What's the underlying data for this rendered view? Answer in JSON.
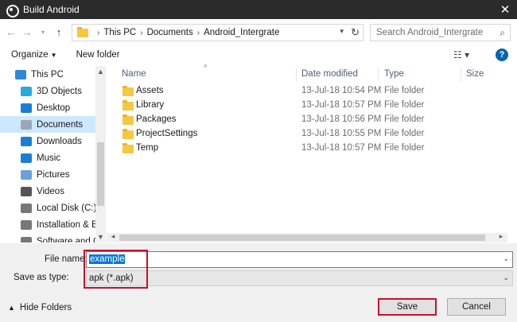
{
  "window": {
    "title": "Build Android",
    "close_label": "✕"
  },
  "address": {
    "breadcrumbs": [
      "This PC",
      "Documents",
      "Android_Intergrate"
    ],
    "search_placeholder": "Search Android_Intergrate"
  },
  "toolbar": {
    "organize_label": "Organize",
    "new_folder_label": "New folder",
    "help_label": "?"
  },
  "nav": {
    "items": [
      {
        "label": "This PC",
        "icon": "pc-icon",
        "color": "#2d89d6",
        "selected": false
      },
      {
        "label": "3D Objects",
        "icon": "cube-icon",
        "color": "#28a9e0",
        "selected": false
      },
      {
        "label": "Desktop",
        "icon": "desktop-icon",
        "color": "#1a7fd4",
        "selected": false
      },
      {
        "label": "Documents",
        "icon": "document-icon",
        "color": "#9aa7b5",
        "selected": true
      },
      {
        "label": "Downloads",
        "icon": "download-icon",
        "color": "#1a7fd4",
        "selected": false
      },
      {
        "label": "Music",
        "icon": "music-icon",
        "color": "#1a7fd4",
        "selected": false
      },
      {
        "label": "Pictures",
        "icon": "picture-icon",
        "color": "#6aa2d8",
        "selected": false
      },
      {
        "label": "Videos",
        "icon": "video-icon",
        "color": "#555",
        "selected": false
      },
      {
        "label": "Local Disk (C:)",
        "icon": "disk-icon",
        "color": "#777",
        "selected": false
      },
      {
        "label": "Installation & Ba",
        "icon": "drive-icon",
        "color": "#777",
        "selected": false
      },
      {
        "label": "Software and C",
        "icon": "drive-icon",
        "color": "#777",
        "selected": false
      }
    ]
  },
  "columns": {
    "name": "Name",
    "date": "Date modified",
    "type": "Type",
    "size": "Size"
  },
  "files": [
    {
      "name": "Assets",
      "date": "13-Jul-18 10:54 PM",
      "type": "File folder"
    },
    {
      "name": "Library",
      "date": "13-Jul-18 10:57 PM",
      "type": "File folder"
    },
    {
      "name": "Packages",
      "date": "13-Jul-18 10:56 PM",
      "type": "File folder"
    },
    {
      "name": "ProjectSettings",
      "date": "13-Jul-18 10:55 PM",
      "type": "File folder"
    },
    {
      "name": "Temp",
      "date": "13-Jul-18 10:57 PM",
      "type": "File folder"
    }
  ],
  "form": {
    "file_name_label": "File name:",
    "file_name_value": "example",
    "save_type_label": "Save as type:",
    "save_type_value": "apk (*.apk)"
  },
  "footer": {
    "hide_folders_label": "Hide Folders",
    "save_label": "Save",
    "cancel_label": "Cancel"
  },
  "colors": {
    "titlebar": "#2b2b2b",
    "selection": "#0078d7",
    "highlight": "#c8102e",
    "nav_selected": "#cce8ff"
  }
}
